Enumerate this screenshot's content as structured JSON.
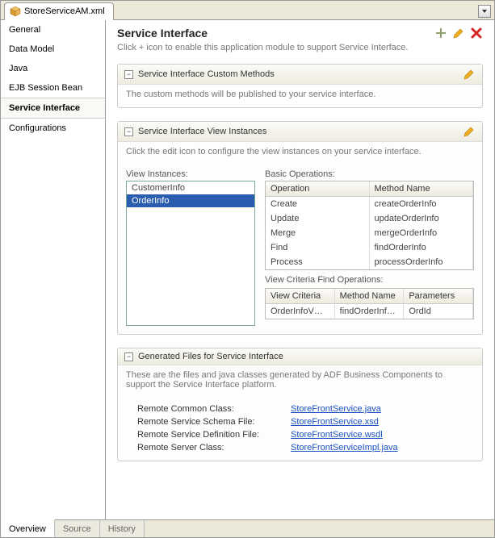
{
  "fileTab": {
    "name": "StoreServiceAM.xml"
  },
  "sidebar": {
    "items": [
      {
        "label": "General"
      },
      {
        "label": "Data Model"
      },
      {
        "label": "Java"
      },
      {
        "label": "EJB Session Bean"
      },
      {
        "label": "Service Interface"
      },
      {
        "label": "Configurations"
      }
    ],
    "selectedIndex": 4
  },
  "page": {
    "title": "Service Interface",
    "subtext": "Click + icon to enable this application module to support Service Interface."
  },
  "sections": {
    "customMethods": {
      "title": "Service Interface Custom Methods",
      "desc": "The custom methods will be published to your service interface."
    },
    "viewInstances": {
      "title": "Service Interface View Instances",
      "desc": "Click the edit icon to configure the view instances on your service interface.",
      "viLabel": "View Instances:",
      "items": [
        "CustomerInfo",
        "OrderInfo"
      ],
      "selectedIndex": 1,
      "basicOpsLabel": "Basic Operations:",
      "basicOpsCols": [
        "Operation",
        "Method Name"
      ],
      "basicOps": [
        {
          "op": "Create",
          "method": "createOrderInfo"
        },
        {
          "op": "Update",
          "method": "updateOrderInfo"
        },
        {
          "op": "Merge",
          "method": "mergeOrderInfo"
        },
        {
          "op": "Find",
          "method": "findOrderInfo"
        },
        {
          "op": "Process",
          "method": "processOrderInfo"
        }
      ],
      "critLabel": "View Criteria Find Operations:",
      "critCols": [
        "View Criteria",
        "Method Name",
        "Parameters"
      ],
      "critRows": [
        {
          "vc": "OrderInfoVOCri...",
          "method": "findOrderInfoOr...",
          "params": "OrdId"
        }
      ]
    },
    "generated": {
      "title": "Generated Files for Service Interface",
      "desc": "These are the files and java classes generated by ADF Business Components to support the Service Interface platform.",
      "rows": [
        {
          "label": "Remote Common Class:",
          "link": "StoreFrontService.java"
        },
        {
          "label": "Remote Service Schema File:",
          "link": "StoreFrontService.xsd"
        },
        {
          "label": "Remote Service Definition File:",
          "link": "StoreFrontService.wsdl"
        },
        {
          "label": "Remote Server Class:",
          "link": "StoreFrontServiceImpl.java"
        }
      ]
    }
  },
  "bottomTabs": {
    "items": [
      "Overview",
      "Source",
      "History"
    ],
    "activeIndex": 0
  }
}
